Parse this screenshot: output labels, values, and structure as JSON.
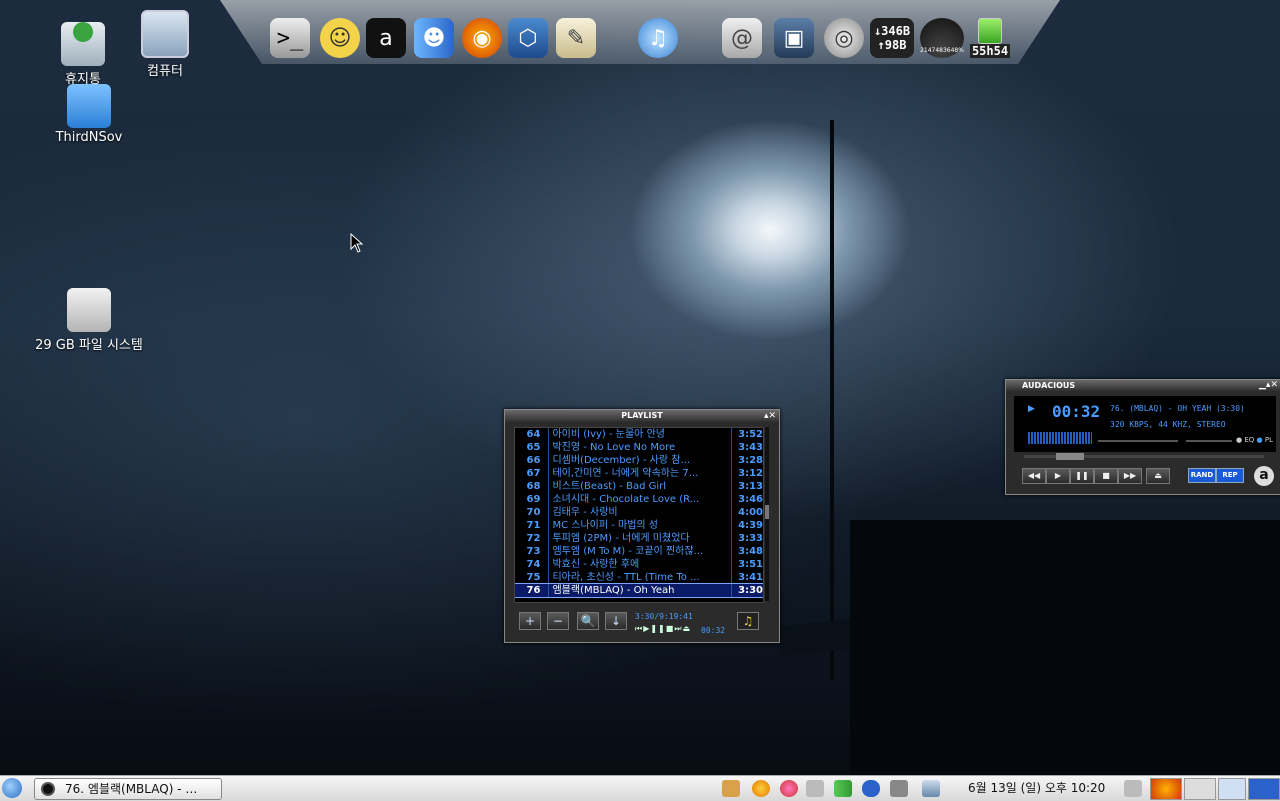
{
  "desktop": {
    "icons": [
      {
        "label": "휴지통",
        "icon": "trash-icon"
      },
      {
        "label": "컴퓨터",
        "icon": "computer-icon"
      },
      {
        "label": "ThirdNSov",
        "icon": "home-folder-icon"
      },
      {
        "label": "29 GB 파일 시스템",
        "icon": "drive-icon"
      }
    ]
  },
  "dock": {
    "net_down": "↓346B",
    "net_up": "↑98B",
    "cpu_gauge": "2147483648%",
    "battery_time": "55h54",
    "items": [
      "terminal-icon",
      "pidgin-icon",
      "audacious-icon",
      "finder-icon",
      "firefox-icon",
      "virtualbox-icon",
      "text-editor-icon",
      "itunes-icon",
      "mail-icon",
      "desktop-icon",
      "speaker-icon",
      "network-monitor-icon",
      "cpu-gauge-icon",
      "battery-icon"
    ]
  },
  "playlist": {
    "title": "PLAYLIST",
    "rows": [
      {
        "num": "64",
        "text": "아이비 (Ivy) - 눈물아 안녕",
        "dur": "3:52"
      },
      {
        "num": "65",
        "text": "박진영 - No Love No More",
        "dur": "3:43"
      },
      {
        "num": "66",
        "text": "디셈버(December) - 사랑 참...",
        "dur": "3:28"
      },
      {
        "num": "67",
        "text": "테이,간미연 - 너에게 약속하는 7...",
        "dur": "3:12"
      },
      {
        "num": "68",
        "text": "비스트(Beast) - Bad Girl",
        "dur": "3:13"
      },
      {
        "num": "69",
        "text": "소녀시대 - Chocolate Love (R...",
        "dur": "3:46"
      },
      {
        "num": "70",
        "text": "김태우 - 사랑비",
        "dur": "4:00"
      },
      {
        "num": "71",
        "text": "MC 스나이퍼 - 마법의 성",
        "dur": "4:39"
      },
      {
        "num": "72",
        "text": "투피엠 (2PM) - 너에게 미쳤었다",
        "dur": "3:33"
      },
      {
        "num": "73",
        "text": "엠투엠 (M To M) - 코끝이 찐하잖...",
        "dur": "3:48"
      },
      {
        "num": "74",
        "text": "박효신 - 사랑한 후에",
        "dur": "3:51"
      },
      {
        "num": "75",
        "text": "티아라, 초신성 - TTL (Time To ...",
        "dur": "3:41"
      },
      {
        "num": "76",
        "text": "엠블랙(MBLAQ) - Oh Yeah",
        "dur": "3:30"
      }
    ],
    "selected_index": 12,
    "info": "3:30/9:19:41",
    "time": "00:32",
    "buttons": [
      "+",
      "−",
      "🔍",
      "↓"
    ]
  },
  "player": {
    "title": "AUDACIOUS",
    "time": "00:32",
    "track": "76.  (MBLAQ) - OH YEAH (3:30)",
    "kbps": "320 KBPS, 44 KHZ, STEREO",
    "eq": "EQ",
    "pl": "PL",
    "rand": "RAND",
    "rep": "REP",
    "controls": [
      "◀◀",
      "▶",
      "❚❚",
      "■",
      "▶▶",
      "⏏"
    ],
    "seek_position": 0.15
  },
  "taskbar": {
    "task_label": "76. 엠블랙(MBLAQ) - …",
    "clock": "6월 13일 (일) 오후 10:20"
  }
}
